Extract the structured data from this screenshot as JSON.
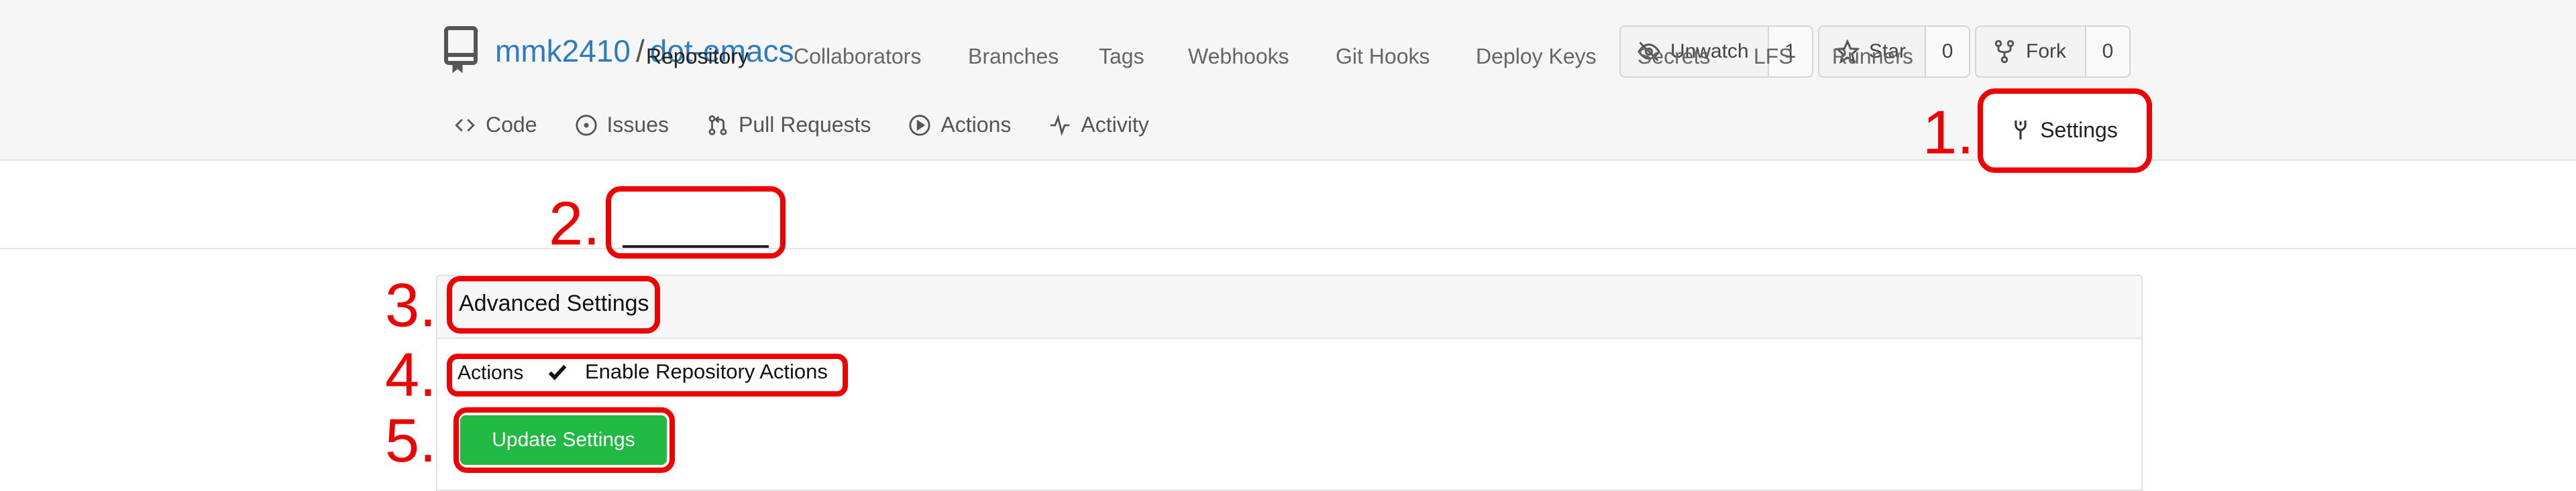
{
  "repo": {
    "owner": "mmk2410",
    "separator": "/",
    "name": "dot-emacs"
  },
  "watch": {
    "label": "Unwatch",
    "count": "1"
  },
  "star": {
    "label": "Star",
    "count": "0"
  },
  "fork": {
    "label": "Fork",
    "count": "0"
  },
  "nav": {
    "code": "Code",
    "issues": "Issues",
    "pulls": "Pull Requests",
    "actions": "Actions",
    "activity": "Activity",
    "settings": "Settings"
  },
  "subnav": {
    "repository": "Repository",
    "collaborators": "Collaborators",
    "branches": "Branches",
    "tags": "Tags",
    "webhooks": "Webhooks",
    "git_hooks": "Git Hooks",
    "deploy_keys": "Deploy Keys",
    "secrets": "Secrets",
    "lfs": "LFS",
    "runners": "Runners"
  },
  "panel": {
    "title": "Advanced Settings",
    "actions_label": "Actions",
    "enable_actions": "Enable Repository Actions",
    "enable_actions_checked": true,
    "update_button": "Update Settings"
  },
  "annotations": {
    "n1": "1.",
    "n2": "2.",
    "n3": "3.",
    "n4": "4.",
    "n5": "5."
  },
  "colors": {
    "link": "#2f7bbf",
    "primary_button": "#21ba45",
    "annotation": "#ee0000"
  }
}
